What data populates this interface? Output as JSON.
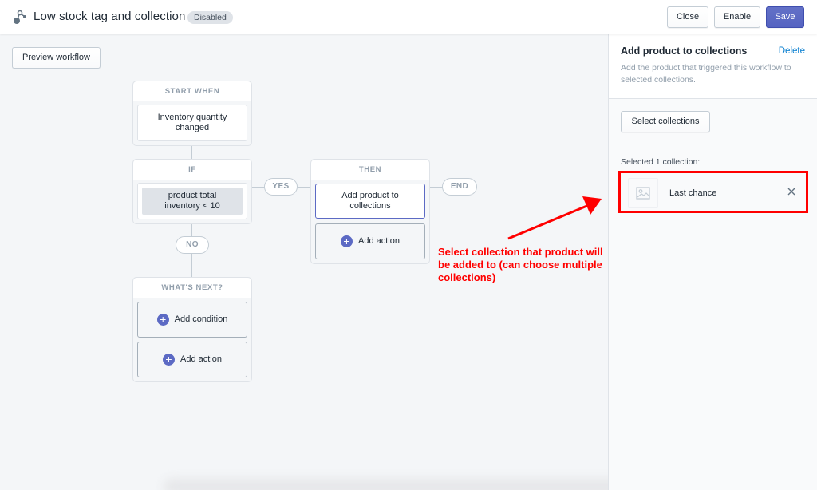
{
  "header": {
    "app_icon": "workflow-icon",
    "title": "Low stock tag and collection",
    "status_badge": "Disabled",
    "buttons": {
      "close": "Close",
      "enable": "Enable",
      "save": "Save"
    },
    "colors": {
      "primary": "#5c6ac4"
    }
  },
  "canvas": {
    "preview_button": "Preview workflow",
    "start_node": {
      "header": "START WHEN",
      "trigger": "Inventory quantity changed"
    },
    "if_node": {
      "header": "IF",
      "condition": "product total inventory < 10"
    },
    "then_node": {
      "header": "THEN",
      "action": "Add product to collections",
      "add_action": "Add action"
    },
    "whats_next_node": {
      "header": "WHAT'S NEXT?",
      "add_condition": "Add condition",
      "add_action": "Add action"
    },
    "pills": {
      "yes": "YES",
      "no": "NO",
      "end": "END"
    },
    "plus_icon": "+"
  },
  "annotation": {
    "text": "Select collection that product will be added to (can choose multiple collections)",
    "color": "#ff0000"
  },
  "sidebar": {
    "title": "Add product to collections",
    "delete_link": "Delete",
    "description": "Add the product that triggered this workflow to selected collections.",
    "select_button": "Select collections",
    "selected_label": "Selected 1 collection:",
    "collections": [
      {
        "name": "Last chance",
        "thumbnail_icon": "image-placeholder-icon",
        "remove_icon": "close-icon"
      }
    ]
  }
}
